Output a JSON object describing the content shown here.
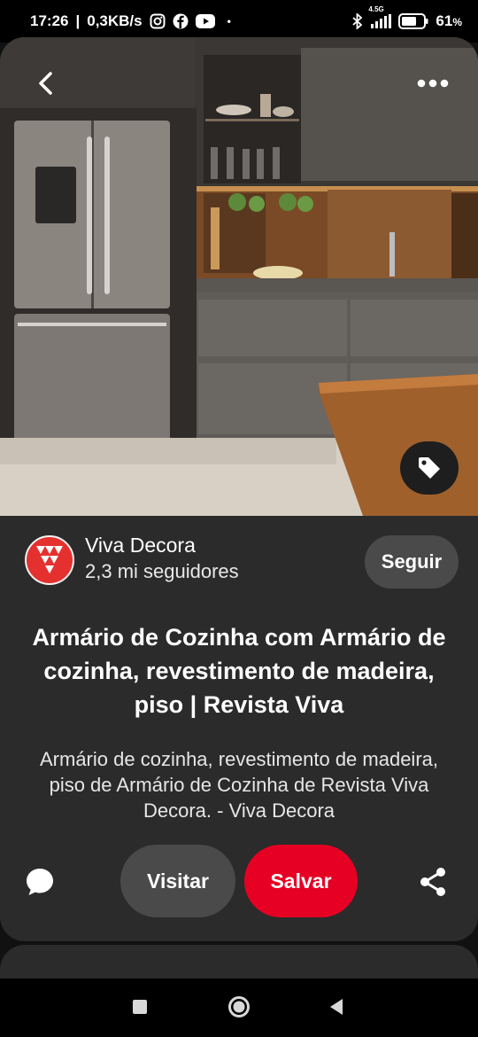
{
  "status_bar": {
    "time": "17:26",
    "speed": "0,3KB/s",
    "dot": "•",
    "network": "4.5G",
    "battery": "61",
    "battery_unit": "%",
    "icons": [
      "instagram-icon",
      "facebook-icon",
      "youtube-icon",
      "bluetooth-icon",
      "signal-icon",
      "battery-icon"
    ]
  },
  "pin": {
    "image_subject": "kitchen-photo",
    "creator": {
      "name": "Viva Decora",
      "followers": "2,3 mi seguidores",
      "follow_label": "Seguir"
    },
    "title": "Armário de Cozinha com Armário de cozinha, revestimento de madeira, piso | Revista Viva",
    "description": "Armário de cozinha, revestimento de madeira, piso de Armário de Cozinha de Revista Viva Decora. - Viva Decora"
  },
  "actions": {
    "visit_label": "Visitar",
    "save_label": "Salvar"
  },
  "colors": {
    "save": "#e60023",
    "avatar": "#e4312f",
    "card": "#2b2b2b",
    "pill": "#4a4a4a"
  }
}
